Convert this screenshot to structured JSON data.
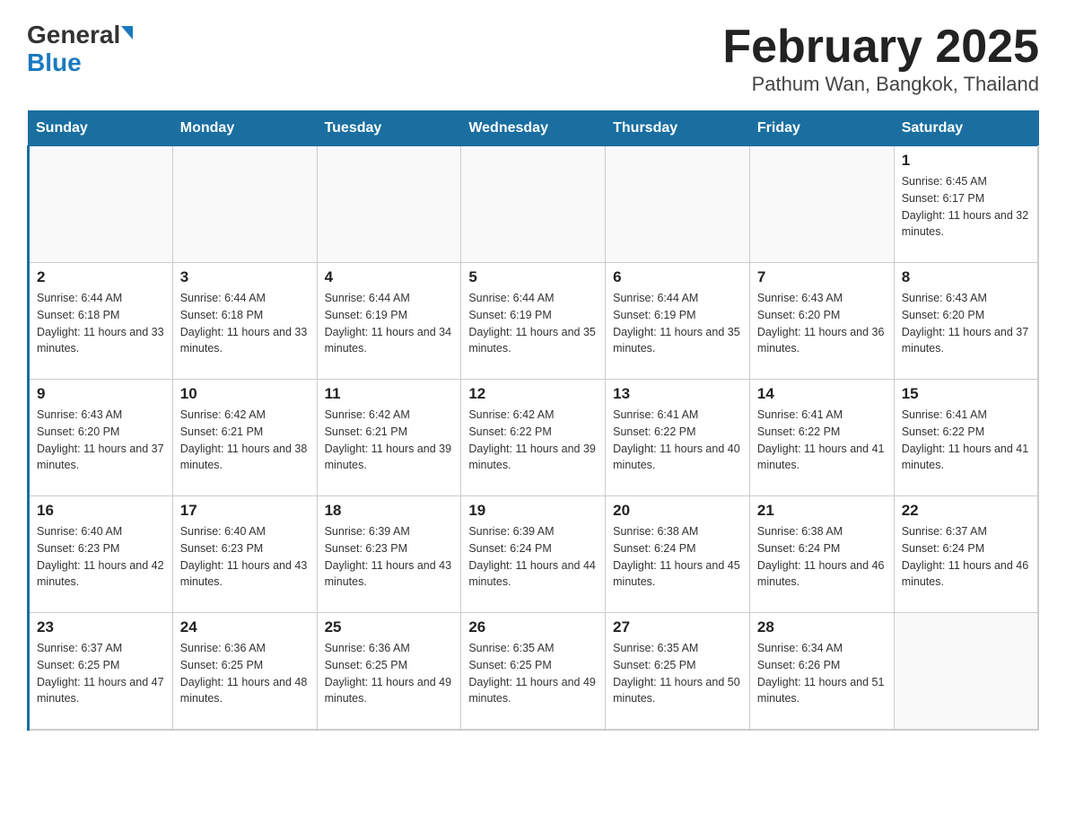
{
  "header": {
    "logo_general": "General",
    "logo_blue": "Blue",
    "title": "February 2025",
    "subtitle": "Pathum Wan, Bangkok, Thailand"
  },
  "calendar": {
    "days_of_week": [
      "Sunday",
      "Monday",
      "Tuesday",
      "Wednesday",
      "Thursday",
      "Friday",
      "Saturday"
    ],
    "weeks": [
      {
        "cells": [
          {
            "day": null,
            "empty": true
          },
          {
            "day": null,
            "empty": true
          },
          {
            "day": null,
            "empty": true
          },
          {
            "day": null,
            "empty": true
          },
          {
            "day": null,
            "empty": true
          },
          {
            "day": null,
            "empty": true
          },
          {
            "day": "1",
            "sunrise": "Sunrise: 6:45 AM",
            "sunset": "Sunset: 6:17 PM",
            "daylight": "Daylight: 11 hours and 32 minutes."
          }
        ]
      },
      {
        "cells": [
          {
            "day": "2",
            "sunrise": "Sunrise: 6:44 AM",
            "sunset": "Sunset: 6:18 PM",
            "daylight": "Daylight: 11 hours and 33 minutes."
          },
          {
            "day": "3",
            "sunrise": "Sunrise: 6:44 AM",
            "sunset": "Sunset: 6:18 PM",
            "daylight": "Daylight: 11 hours and 33 minutes."
          },
          {
            "day": "4",
            "sunrise": "Sunrise: 6:44 AM",
            "sunset": "Sunset: 6:19 PM",
            "daylight": "Daylight: 11 hours and 34 minutes."
          },
          {
            "day": "5",
            "sunrise": "Sunrise: 6:44 AM",
            "sunset": "Sunset: 6:19 PM",
            "daylight": "Daylight: 11 hours and 35 minutes."
          },
          {
            "day": "6",
            "sunrise": "Sunrise: 6:44 AM",
            "sunset": "Sunset: 6:19 PM",
            "daylight": "Daylight: 11 hours and 35 minutes."
          },
          {
            "day": "7",
            "sunrise": "Sunrise: 6:43 AM",
            "sunset": "Sunset: 6:20 PM",
            "daylight": "Daylight: 11 hours and 36 minutes."
          },
          {
            "day": "8",
            "sunrise": "Sunrise: 6:43 AM",
            "sunset": "Sunset: 6:20 PM",
            "daylight": "Daylight: 11 hours and 37 minutes."
          }
        ]
      },
      {
        "cells": [
          {
            "day": "9",
            "sunrise": "Sunrise: 6:43 AM",
            "sunset": "Sunset: 6:20 PM",
            "daylight": "Daylight: 11 hours and 37 minutes."
          },
          {
            "day": "10",
            "sunrise": "Sunrise: 6:42 AM",
            "sunset": "Sunset: 6:21 PM",
            "daylight": "Daylight: 11 hours and 38 minutes."
          },
          {
            "day": "11",
            "sunrise": "Sunrise: 6:42 AM",
            "sunset": "Sunset: 6:21 PM",
            "daylight": "Daylight: 11 hours and 39 minutes."
          },
          {
            "day": "12",
            "sunrise": "Sunrise: 6:42 AM",
            "sunset": "Sunset: 6:22 PM",
            "daylight": "Daylight: 11 hours and 39 minutes."
          },
          {
            "day": "13",
            "sunrise": "Sunrise: 6:41 AM",
            "sunset": "Sunset: 6:22 PM",
            "daylight": "Daylight: 11 hours and 40 minutes."
          },
          {
            "day": "14",
            "sunrise": "Sunrise: 6:41 AM",
            "sunset": "Sunset: 6:22 PM",
            "daylight": "Daylight: 11 hours and 41 minutes."
          },
          {
            "day": "15",
            "sunrise": "Sunrise: 6:41 AM",
            "sunset": "Sunset: 6:22 PM",
            "daylight": "Daylight: 11 hours and 41 minutes."
          }
        ]
      },
      {
        "cells": [
          {
            "day": "16",
            "sunrise": "Sunrise: 6:40 AM",
            "sunset": "Sunset: 6:23 PM",
            "daylight": "Daylight: 11 hours and 42 minutes."
          },
          {
            "day": "17",
            "sunrise": "Sunrise: 6:40 AM",
            "sunset": "Sunset: 6:23 PM",
            "daylight": "Daylight: 11 hours and 43 minutes."
          },
          {
            "day": "18",
            "sunrise": "Sunrise: 6:39 AM",
            "sunset": "Sunset: 6:23 PM",
            "daylight": "Daylight: 11 hours and 43 minutes."
          },
          {
            "day": "19",
            "sunrise": "Sunrise: 6:39 AM",
            "sunset": "Sunset: 6:24 PM",
            "daylight": "Daylight: 11 hours and 44 minutes."
          },
          {
            "day": "20",
            "sunrise": "Sunrise: 6:38 AM",
            "sunset": "Sunset: 6:24 PM",
            "daylight": "Daylight: 11 hours and 45 minutes."
          },
          {
            "day": "21",
            "sunrise": "Sunrise: 6:38 AM",
            "sunset": "Sunset: 6:24 PM",
            "daylight": "Daylight: 11 hours and 46 minutes."
          },
          {
            "day": "22",
            "sunrise": "Sunrise: 6:37 AM",
            "sunset": "Sunset: 6:24 PM",
            "daylight": "Daylight: 11 hours and 46 minutes."
          }
        ]
      },
      {
        "cells": [
          {
            "day": "23",
            "sunrise": "Sunrise: 6:37 AM",
            "sunset": "Sunset: 6:25 PM",
            "daylight": "Daylight: 11 hours and 47 minutes."
          },
          {
            "day": "24",
            "sunrise": "Sunrise: 6:36 AM",
            "sunset": "Sunset: 6:25 PM",
            "daylight": "Daylight: 11 hours and 48 minutes."
          },
          {
            "day": "25",
            "sunrise": "Sunrise: 6:36 AM",
            "sunset": "Sunset: 6:25 PM",
            "daylight": "Daylight: 11 hours and 49 minutes."
          },
          {
            "day": "26",
            "sunrise": "Sunrise: 6:35 AM",
            "sunset": "Sunset: 6:25 PM",
            "daylight": "Daylight: 11 hours and 49 minutes."
          },
          {
            "day": "27",
            "sunrise": "Sunrise: 6:35 AM",
            "sunset": "Sunset: 6:25 PM",
            "daylight": "Daylight: 11 hours and 50 minutes."
          },
          {
            "day": "28",
            "sunrise": "Sunrise: 6:34 AM",
            "sunset": "Sunset: 6:26 PM",
            "daylight": "Daylight: 11 hours and 51 minutes."
          },
          {
            "day": null,
            "empty": true
          }
        ]
      }
    ]
  }
}
